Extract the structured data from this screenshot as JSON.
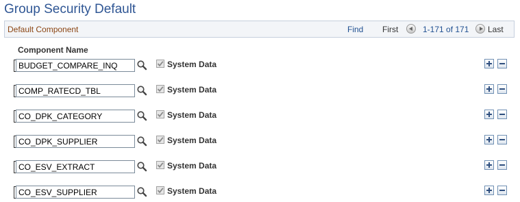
{
  "page": {
    "title": "Group Security Default"
  },
  "grid": {
    "title": "Default Component",
    "find_label": "Find",
    "first_label": "First",
    "range_text": "1-171 of 171",
    "last_label": "Last",
    "column_header": "Component Name",
    "checkbox_label": "System Data",
    "rows": [
      {
        "component": "BUDGET_COMPARE_INQ",
        "system_data": true
      },
      {
        "component": "COMP_RATECD_TBL",
        "system_data": true
      },
      {
        "component": "CO_DPK_CATEGORY",
        "system_data": true
      },
      {
        "component": "CO_DPK_SUPPLIER",
        "system_data": true
      },
      {
        "component": "CO_ESV_EXTRACT",
        "system_data": true
      },
      {
        "component": "CO_ESV_SUPPLIER",
        "system_data": true
      }
    ]
  },
  "icons": {
    "lookup": "search-icon",
    "add_row": "plus-icon",
    "delete_row": "minus-icon",
    "prev": "arrow-left-icon",
    "next": "arrow-right-icon"
  },
  "colors": {
    "title": "#2f5694",
    "grid_title": "#8b4513",
    "link": "#1f4f90"
  }
}
